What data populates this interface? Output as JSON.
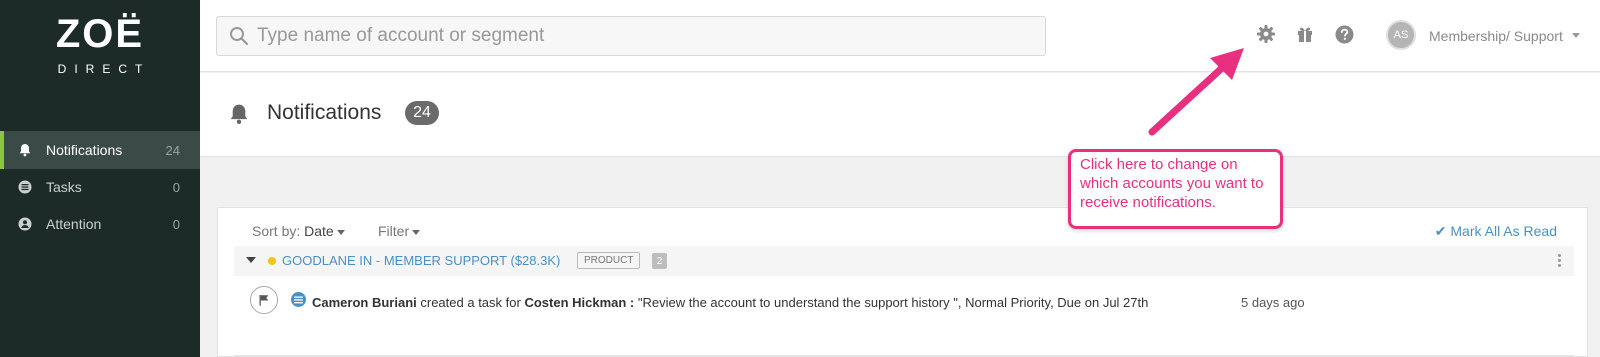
{
  "app": {
    "logo_main": "ZOË",
    "logo_sub": "DIRECT"
  },
  "sidebar": {
    "items": [
      {
        "label": "Notifications",
        "count": "24",
        "icon": "bell-icon",
        "active": true
      },
      {
        "label": "Tasks",
        "count": "0",
        "icon": "list-icon",
        "active": false
      },
      {
        "label": "Attention",
        "count": "0",
        "icon": "attention-icon",
        "active": false
      }
    ]
  },
  "topbar": {
    "search_placeholder": "Type name of account or segment",
    "icons": [
      "gear-icon",
      "gift-icon",
      "help-icon"
    ],
    "avatar_initials": "AS",
    "user_label": "Membership/ Support"
  },
  "header": {
    "title": "Notifications",
    "count": "24"
  },
  "toolbar": {
    "sort_label": "Sort by:",
    "sort_value": "Date",
    "filter_label": "Filter",
    "mark_all_label": "Mark All As Read"
  },
  "group": {
    "name": "GOODLANE IN - MEMBER SUPPORT ($28.3K)",
    "tag": "PRODUCT",
    "count": "2",
    "status_color": "#f0c419"
  },
  "notification": {
    "actor": "Cameron Buriani",
    "action": "created a task for",
    "target": "Costen Hickman :",
    "detail": "\"Review the account to understand the support history \", Normal Priority, Due on Jul 27th",
    "time": "5 days ago"
  },
  "annotation": {
    "text": "Click here to change on which accounts you want to receive notifications.",
    "color": "#e8307f"
  },
  "colors": {
    "sidebar_bg": "#1c2b28",
    "active_accent": "#8cc63f",
    "link": "#4a90c8"
  }
}
